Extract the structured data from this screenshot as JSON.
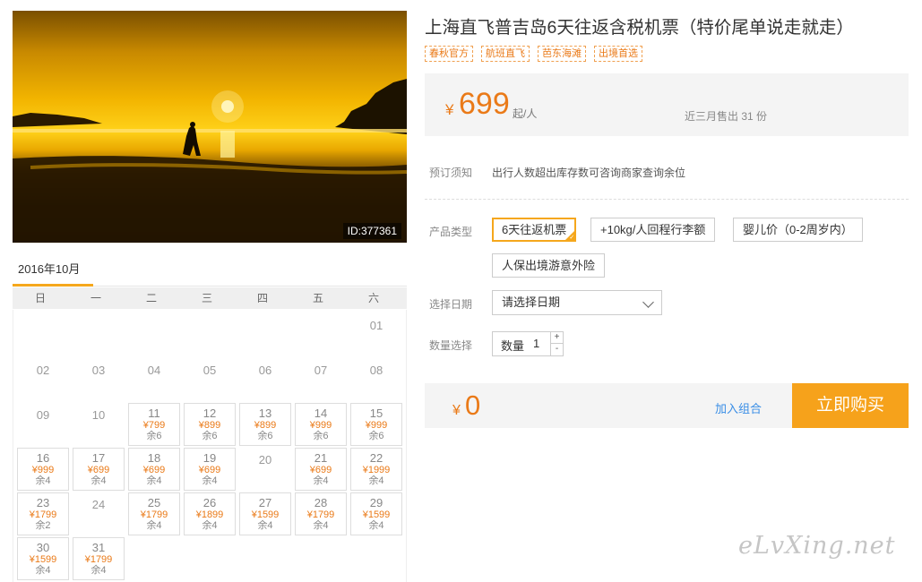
{
  "photo": {
    "id_label": "ID:377361"
  },
  "product": {
    "title": "上海直飞普吉岛6天往返含税机票（特价尾单说走就走）",
    "tags": [
      "春秋官方",
      "航班直飞",
      "芭东海滩",
      "出境首选"
    ]
  },
  "price": {
    "currency": "¥",
    "value": "699",
    "unit": "起/人",
    "sold": "近三月售出 31 份"
  },
  "notice": {
    "label": "预订须知",
    "text": "出行人数超出库存数可咨询商家查询余位"
  },
  "product_type": {
    "label": "产品类型",
    "options": [
      "6天往返机票",
      "+10kg/人回程行李额",
      "婴儿价（0-2周岁内）",
      "人保出境游意外险"
    ],
    "selected_index": 0
  },
  "date": {
    "label": "选择日期",
    "placeholder": "请选择日期"
  },
  "quantity": {
    "label": "数量选择",
    "field_label": "数量",
    "value": "1",
    "plus": "+",
    "minus": "-"
  },
  "total": {
    "currency": "¥",
    "value": "0",
    "add_combo": "加入组合",
    "buy_label": "立即购买"
  },
  "calendar": {
    "month_label": "2016年10月",
    "weekdays": [
      "日",
      "一",
      "二",
      "三",
      "四",
      "五",
      "六"
    ],
    "rows": [
      [
        null,
        null,
        null,
        null,
        null,
        null,
        {
          "d": "01"
        }
      ],
      [
        {
          "d": "02"
        },
        {
          "d": "03"
        },
        {
          "d": "04"
        },
        {
          "d": "05"
        },
        {
          "d": "06"
        },
        {
          "d": "07"
        },
        {
          "d": "08"
        }
      ],
      [
        {
          "d": "09"
        },
        {
          "d": "10"
        },
        {
          "d": "11",
          "p": "¥799",
          "r": "余6"
        },
        {
          "d": "12",
          "p": "¥899",
          "r": "余6"
        },
        {
          "d": "13",
          "p": "¥899",
          "r": "余6"
        },
        {
          "d": "14",
          "p": "¥999",
          "r": "余6"
        },
        {
          "d": "15",
          "p": "¥999",
          "r": "余6"
        }
      ],
      [
        {
          "d": "16",
          "p": "¥999",
          "r": "余4"
        },
        {
          "d": "17",
          "p": "¥699",
          "r": "余4"
        },
        {
          "d": "18",
          "p": "¥699",
          "r": "余4"
        },
        {
          "d": "19",
          "p": "¥699",
          "r": "余4"
        },
        {
          "d": "20"
        },
        {
          "d": "21",
          "p": "¥699",
          "r": "余4"
        },
        {
          "d": "22",
          "p": "¥1999",
          "r": "余4"
        }
      ],
      [
        {
          "d": "23",
          "p": "¥1799",
          "r": "余2"
        },
        {
          "d": "24"
        },
        {
          "d": "25",
          "p": "¥1799",
          "r": "余4"
        },
        {
          "d": "26",
          "p": "¥1899",
          "r": "余4"
        },
        {
          "d": "27",
          "p": "¥1599",
          "r": "余4"
        },
        {
          "d": "28",
          "p": "¥1799",
          "r": "余4"
        },
        {
          "d": "29",
          "p": "¥1599",
          "r": "余4"
        }
      ],
      [
        {
          "d": "30",
          "p": "¥1599",
          "r": "余4"
        },
        {
          "d": "31",
          "p": "¥1799",
          "r": "余4"
        },
        null,
        null,
        null,
        null,
        null
      ]
    ]
  },
  "watermark": "eLvXing.net",
  "colors": {
    "accent": "#f5a71c",
    "price": "#ea7a18",
    "link": "#3a8ee6"
  }
}
